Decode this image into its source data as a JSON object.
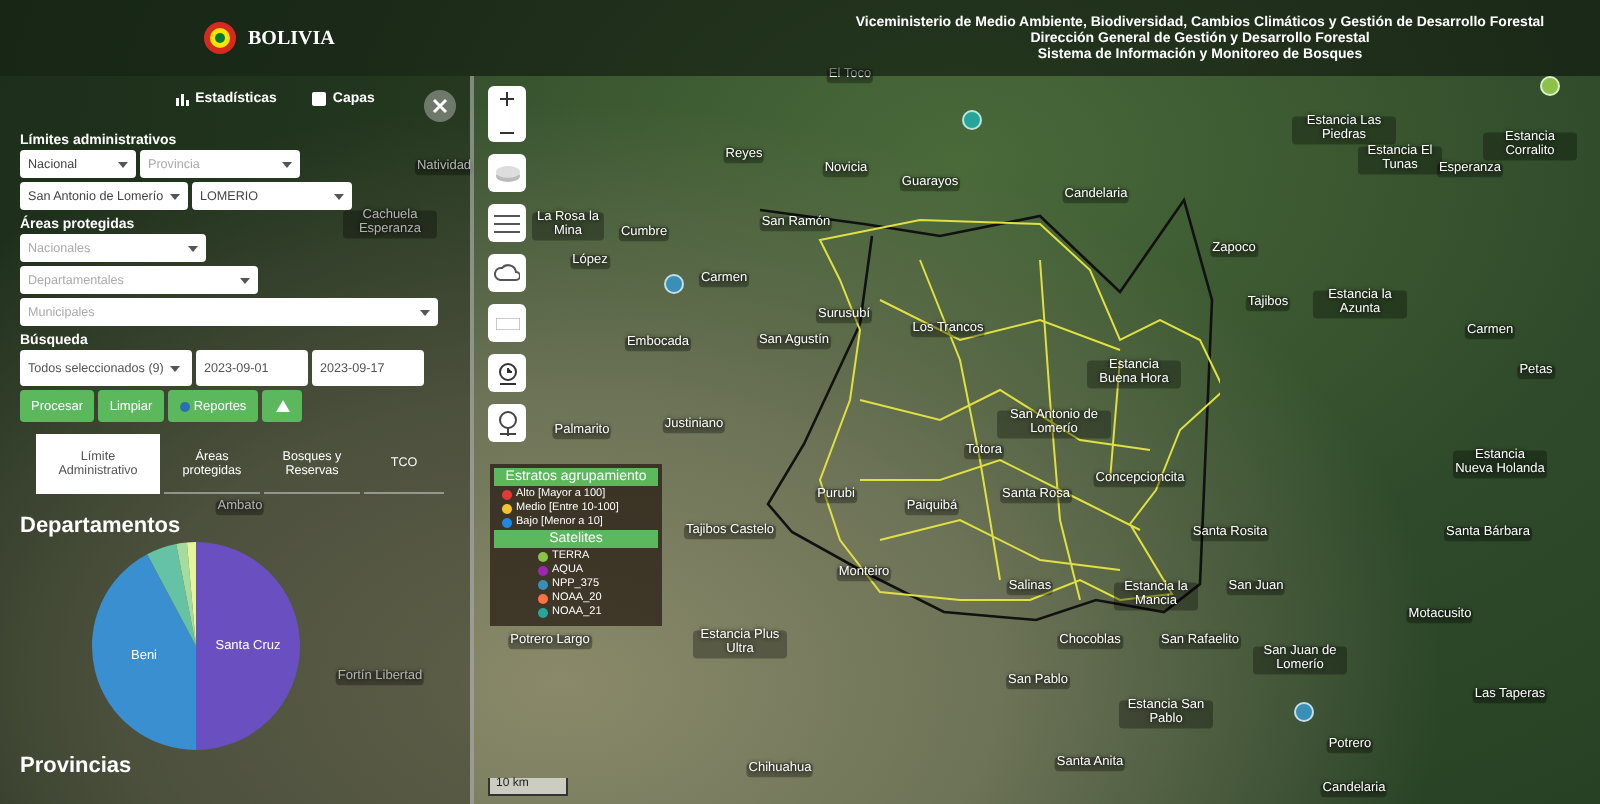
{
  "header": {
    "logo_text": "BOLIVIA",
    "title_lines": [
      "Viceministerio de Medio Ambiente, Biodiversidad, Cambios Climáticos y Gestión de Desarrollo Forestal",
      "Dirección General de Gestión y Desarrollo Forestal",
      "Sistema de Información y Monitoreo de Bosques"
    ]
  },
  "panel": {
    "tabs": [
      {
        "label": "Estadísticas"
      },
      {
        "label": "Capas"
      }
    ],
    "limits": {
      "title": "Límites administrativos",
      "selects": [
        {
          "value": "Nacional"
        },
        {
          "placeholder": "Provincia"
        },
        {
          "value": "San Antonio de Lomerío"
        },
        {
          "value": "LOMERIO"
        }
      ]
    },
    "protected": {
      "title": "Áreas protegidas",
      "selects": [
        {
          "placeholder": "Nacionales"
        },
        {
          "placeholder": "Departamentales"
        },
        {
          "placeholder": "Municipales"
        }
      ]
    },
    "search": {
      "title": "Búsqueda",
      "satellites": "Todos seleccionados (9)",
      "date_from": "2023-09-01",
      "date_to": "2023-09-17"
    },
    "buttons": [
      {
        "label": "Procesar"
      },
      {
        "label": "Limpiar"
      },
      {
        "label": "Reportes"
      }
    ],
    "subtabs": [
      {
        "label": "Límite Administrativo",
        "selected": true
      },
      {
        "label": "Áreas protegidas",
        "selected": false
      },
      {
        "label": "Bosques y Reservas",
        "selected": false
      },
      {
        "label": "TCO",
        "selected": false
      }
    ],
    "chart_title": "Departamentos",
    "slices": [
      "Santa Cruz",
      "Beni"
    ],
    "next_title": "Provincias"
  },
  "legend": {
    "strata_title": "Estratos agrupamiento",
    "strata": [
      {
        "label": "Alto [Mayor a 100]",
        "color": "#e53935"
      },
      {
        "label": "Medio [Entre 10-100]",
        "color": "#f4c430"
      },
      {
        "label": "Bajo [Menor a 10]",
        "color": "#1e88e5"
      }
    ],
    "satellites_title": "Satelites",
    "satellites": [
      {
        "label": "TERRA",
        "color": "#8bc34a"
      },
      {
        "label": "AQUA",
        "color": "#9c27b0"
      },
      {
        "label": "NPP_375",
        "color": "#3a8fb7"
      },
      {
        "label": "NOAA_20",
        "color": "#ff7043"
      },
      {
        "label": "NOAA_21",
        "color": "#26a69a"
      }
    ]
  },
  "map": {
    "scale": "10 km",
    "places": [
      "El Toco",
      "Natividad",
      "Reyes",
      "Novicia",
      "Guarayos",
      "Estancia Las Piedras",
      "Estancia El Tunas",
      "Esperanza",
      "Estancia Corralito",
      "Candelaria",
      "Cachuela Esperanza",
      "La Rosa la Mina",
      "Cumbre",
      "San Ramón",
      "Zapoco",
      "López",
      "Carmen",
      "Tajibos",
      "Estancia la Azunta",
      "Surusubí",
      "Los Trancos",
      "Carmen",
      "Embocada",
      "San Agustín",
      "Estancia Buena Hora",
      "Petas",
      "Palmarito",
      "Justiniano",
      "San Antonio de Lomerío",
      "Totora",
      "Estancia Nueva Holanda",
      "Concepcioncita",
      "Purubi",
      "Santa Rosa",
      "Ambato",
      "Paiquibá",
      "Tajibos Castelo",
      "Santa Rosita",
      "Santa Bárbara",
      "Monteiro",
      "Salinas",
      "Estancia la Mancia",
      "San Juan",
      "Motacusito",
      "Potrero Largo",
      "Estancia Plus Ultra",
      "Chocoblas",
      "San Rafaelito",
      "San Juan de Lomerío",
      "Fortín Libertad",
      "San Pablo",
      "Las Taperas",
      "Estancia San Pablo",
      "Potrero",
      "Santa Anita",
      "Chihuahua",
      "Candelaria"
    ],
    "hotspots": [
      {
        "color": "#26a69a"
      },
      {
        "color": "#3a8fb7"
      },
      {
        "color": "#8bc34a"
      },
      {
        "color": "#3a8fb7"
      }
    ]
  }
}
